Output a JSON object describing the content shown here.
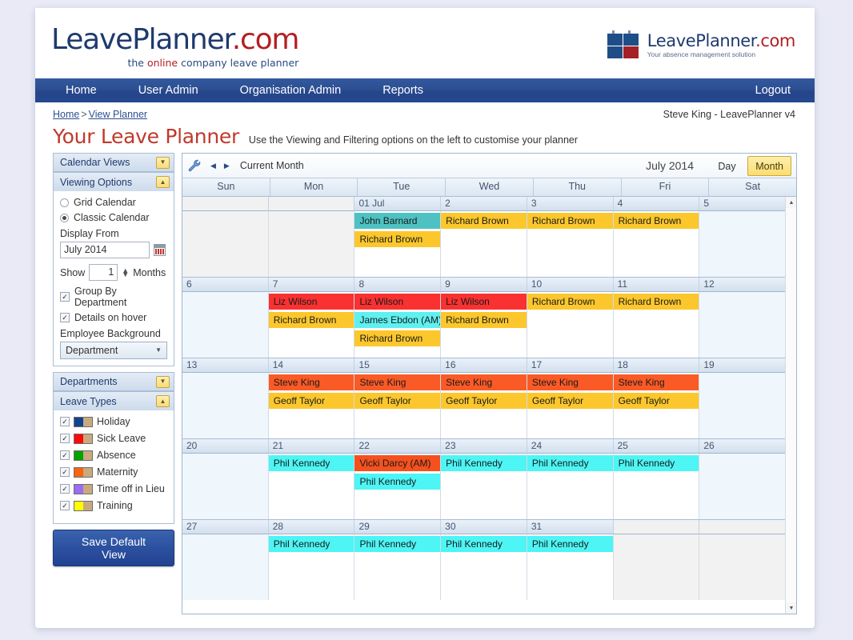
{
  "brand": {
    "left_logo_main": "LeavePlanner",
    "left_logo_dotcom": ".com",
    "left_tagline_pre": "the ",
    "left_tagline_hl": "online",
    "left_tagline_post": " company leave planner",
    "right_logo_main": "LeavePlanner",
    "right_logo_dotcom": ".com",
    "right_logo_sub": "Your absence management solution",
    "mark_blue": "#1f4e87",
    "mark_red": "#a42026"
  },
  "nav": {
    "items": [
      {
        "label": "Home"
      },
      {
        "label": "User Admin"
      },
      {
        "label": "Organisation Admin"
      },
      {
        "label": "Reports"
      }
    ],
    "logout": "Logout"
  },
  "breadcrumb": {
    "home": "Home",
    "separator": ">",
    "current": "View Planner"
  },
  "user_info": "Steve King - LeavePlanner v4",
  "page": {
    "title": "Your Leave Planner",
    "subtitle": "Use the Viewing and Filtering options on the left to customise your planner"
  },
  "sidebar": {
    "panels": {
      "calendar_views": {
        "title": "Calendar Views",
        "state": "collapsed"
      },
      "viewing_options": {
        "title": "Viewing Options",
        "state": "expanded"
      },
      "departments": {
        "title": "Departments",
        "state": "collapsed"
      },
      "leave_types": {
        "title": "Leave Types",
        "state": "expanded"
      }
    },
    "viewing_options": {
      "grid_calendar_label": "Grid Calendar",
      "grid_calendar_selected": false,
      "classic_calendar_label": "Classic Calendar",
      "classic_calendar_selected": true,
      "display_from_label": "Display From",
      "display_from_value": "July 2014",
      "show_label": "Show",
      "show_value": "1",
      "months_label": "Months",
      "group_by_department_label": "Group By Department",
      "group_by_department_checked": true,
      "details_on_hover_label": "Details on hover",
      "details_on_hover_checked": true,
      "employee_background_label": "Employee Background",
      "employee_background_value": "Department"
    },
    "leave_types": [
      {
        "label": "Holiday",
        "color": "#12438f",
        "checked": true
      },
      {
        "label": "Sick Leave",
        "color": "#fb0a0a",
        "checked": true
      },
      {
        "label": "Absence",
        "color": "#00a200",
        "checked": true
      },
      {
        "label": "Maternity",
        "color": "#fa6312",
        "checked": true
      },
      {
        "label": "Time off in Lieu",
        "color": "#9c6cf4",
        "checked": true
      },
      {
        "label": "Training",
        "color": "#ffff00",
        "checked": true
      }
    ],
    "save_default_view": "Save Default View",
    "save_default_view_line1": "Save Default",
    "save_default_view_line2": "View"
  },
  "calendar": {
    "toolbar": {
      "settings_icon": "wrench-icon",
      "prev_label": "◀",
      "next_label": "▶",
      "current_label": "Current Month",
      "month_year": "July 2014",
      "day_button": "Day",
      "month_button": "Month",
      "active_view": "Month"
    },
    "day_headers": [
      "Sun",
      "Mon",
      "Tue",
      "Wed",
      "Thu",
      "Fri",
      "Sat"
    ],
    "weeks": [
      {
        "days": [
          {
            "num": "",
            "off": true,
            "events": []
          },
          {
            "num": "",
            "off": true,
            "events": []
          },
          {
            "num": "01 Jul",
            "events": [
              {
                "name": "John Barnard",
                "color": "#4ec2c2"
              },
              {
                "name": "Richard Brown",
                "color": "#fbc72c"
              }
            ]
          },
          {
            "num": "2",
            "events": [
              {
                "name": "Richard Brown",
                "color": "#fbc72c"
              }
            ]
          },
          {
            "num": "3",
            "events": [
              {
                "name": "Richard Brown",
                "color": "#fbc72c"
              }
            ]
          },
          {
            "num": "4",
            "events": [
              {
                "name": "Richard Brown",
                "color": "#fbc72c"
              }
            ]
          },
          {
            "num": "5",
            "events": []
          }
        ]
      },
      {
        "days": [
          {
            "num": "6",
            "events": []
          },
          {
            "num": "7",
            "events": [
              {
                "name": "Liz Wilson",
                "color": "#f93131"
              },
              {
                "name": "Richard Brown",
                "color": "#fbc72c"
              }
            ]
          },
          {
            "num": "8",
            "events": [
              {
                "name": "Liz Wilson",
                "color": "#f93131"
              },
              {
                "name": "James Ebdon (AM)",
                "color": "#5ff0f0"
              },
              {
                "name": "Richard Brown",
                "color": "#fbc72c"
              }
            ]
          },
          {
            "num": "9",
            "events": [
              {
                "name": "Liz Wilson",
                "color": "#f93131"
              },
              {
                "name": "Richard Brown",
                "color": "#fbc72c"
              }
            ]
          },
          {
            "num": "10",
            "events": [
              {
                "name": "Richard Brown",
                "color": "#fbc72c"
              }
            ]
          },
          {
            "num": "11",
            "events": [
              {
                "name": "Richard Brown",
                "color": "#fbc72c"
              }
            ]
          },
          {
            "num": "12",
            "events": []
          }
        ]
      },
      {
        "days": [
          {
            "num": "13",
            "events": []
          },
          {
            "num": "14",
            "events": [
              {
                "name": "Steve King",
                "color": "#fa5a26"
              },
              {
                "name": "Geoff Taylor",
                "color": "#fbc72c"
              }
            ]
          },
          {
            "num": "15",
            "events": [
              {
                "name": "Steve King",
                "color": "#fa5a26"
              },
              {
                "name": "Geoff Taylor",
                "color": "#fbc72c"
              }
            ]
          },
          {
            "num": "16",
            "events": [
              {
                "name": "Steve King",
                "color": "#fa5a26"
              },
              {
                "name": "Geoff Taylor",
                "color": "#fbc72c"
              }
            ]
          },
          {
            "num": "17",
            "events": [
              {
                "name": "Steve King",
                "color": "#fa5a26"
              },
              {
                "name": "Geoff Taylor",
                "color": "#fbc72c"
              }
            ]
          },
          {
            "num": "18",
            "events": [
              {
                "name": "Steve King",
                "color": "#fa5a26"
              },
              {
                "name": "Geoff Taylor",
                "color": "#fbc72c"
              }
            ]
          },
          {
            "num": "19",
            "events": []
          }
        ]
      },
      {
        "days": [
          {
            "num": "20",
            "events": []
          },
          {
            "num": "21",
            "events": [
              {
                "name": "Phil Kennedy",
                "color": "#4df5f5"
              }
            ]
          },
          {
            "num": "22",
            "events": [
              {
                "name": "Vicki Darcy (AM)",
                "color": "#f4511e"
              },
              {
                "name": "Phil Kennedy",
                "color": "#4df5f5"
              }
            ]
          },
          {
            "num": "23",
            "events": [
              {
                "name": "Phil Kennedy",
                "color": "#4df5f5"
              }
            ]
          },
          {
            "num": "24",
            "events": [
              {
                "name": "Phil Kennedy",
                "color": "#4df5f5"
              }
            ]
          },
          {
            "num": "25",
            "events": [
              {
                "name": "Phil Kennedy",
                "color": "#4df5f5"
              }
            ]
          },
          {
            "num": "26",
            "events": []
          }
        ]
      },
      {
        "days": [
          {
            "num": "27",
            "events": []
          },
          {
            "num": "28",
            "events": [
              {
                "name": "Phil Kennedy",
                "color": "#4df5f5"
              }
            ]
          },
          {
            "num": "29",
            "events": [
              {
                "name": "Phil Kennedy",
                "color": "#4df5f5"
              }
            ]
          },
          {
            "num": "30",
            "events": [
              {
                "name": "Phil Kennedy",
                "color": "#4df5f5"
              }
            ]
          },
          {
            "num": "31",
            "events": [
              {
                "name": "Phil Kennedy",
                "color": "#4df5f5"
              }
            ]
          },
          {
            "num": "",
            "off": true,
            "events": []
          },
          {
            "num": "",
            "off": true,
            "events": []
          }
        ]
      }
    ],
    "scrollbar": {
      "up": "▲",
      "down": "▼"
    }
  }
}
